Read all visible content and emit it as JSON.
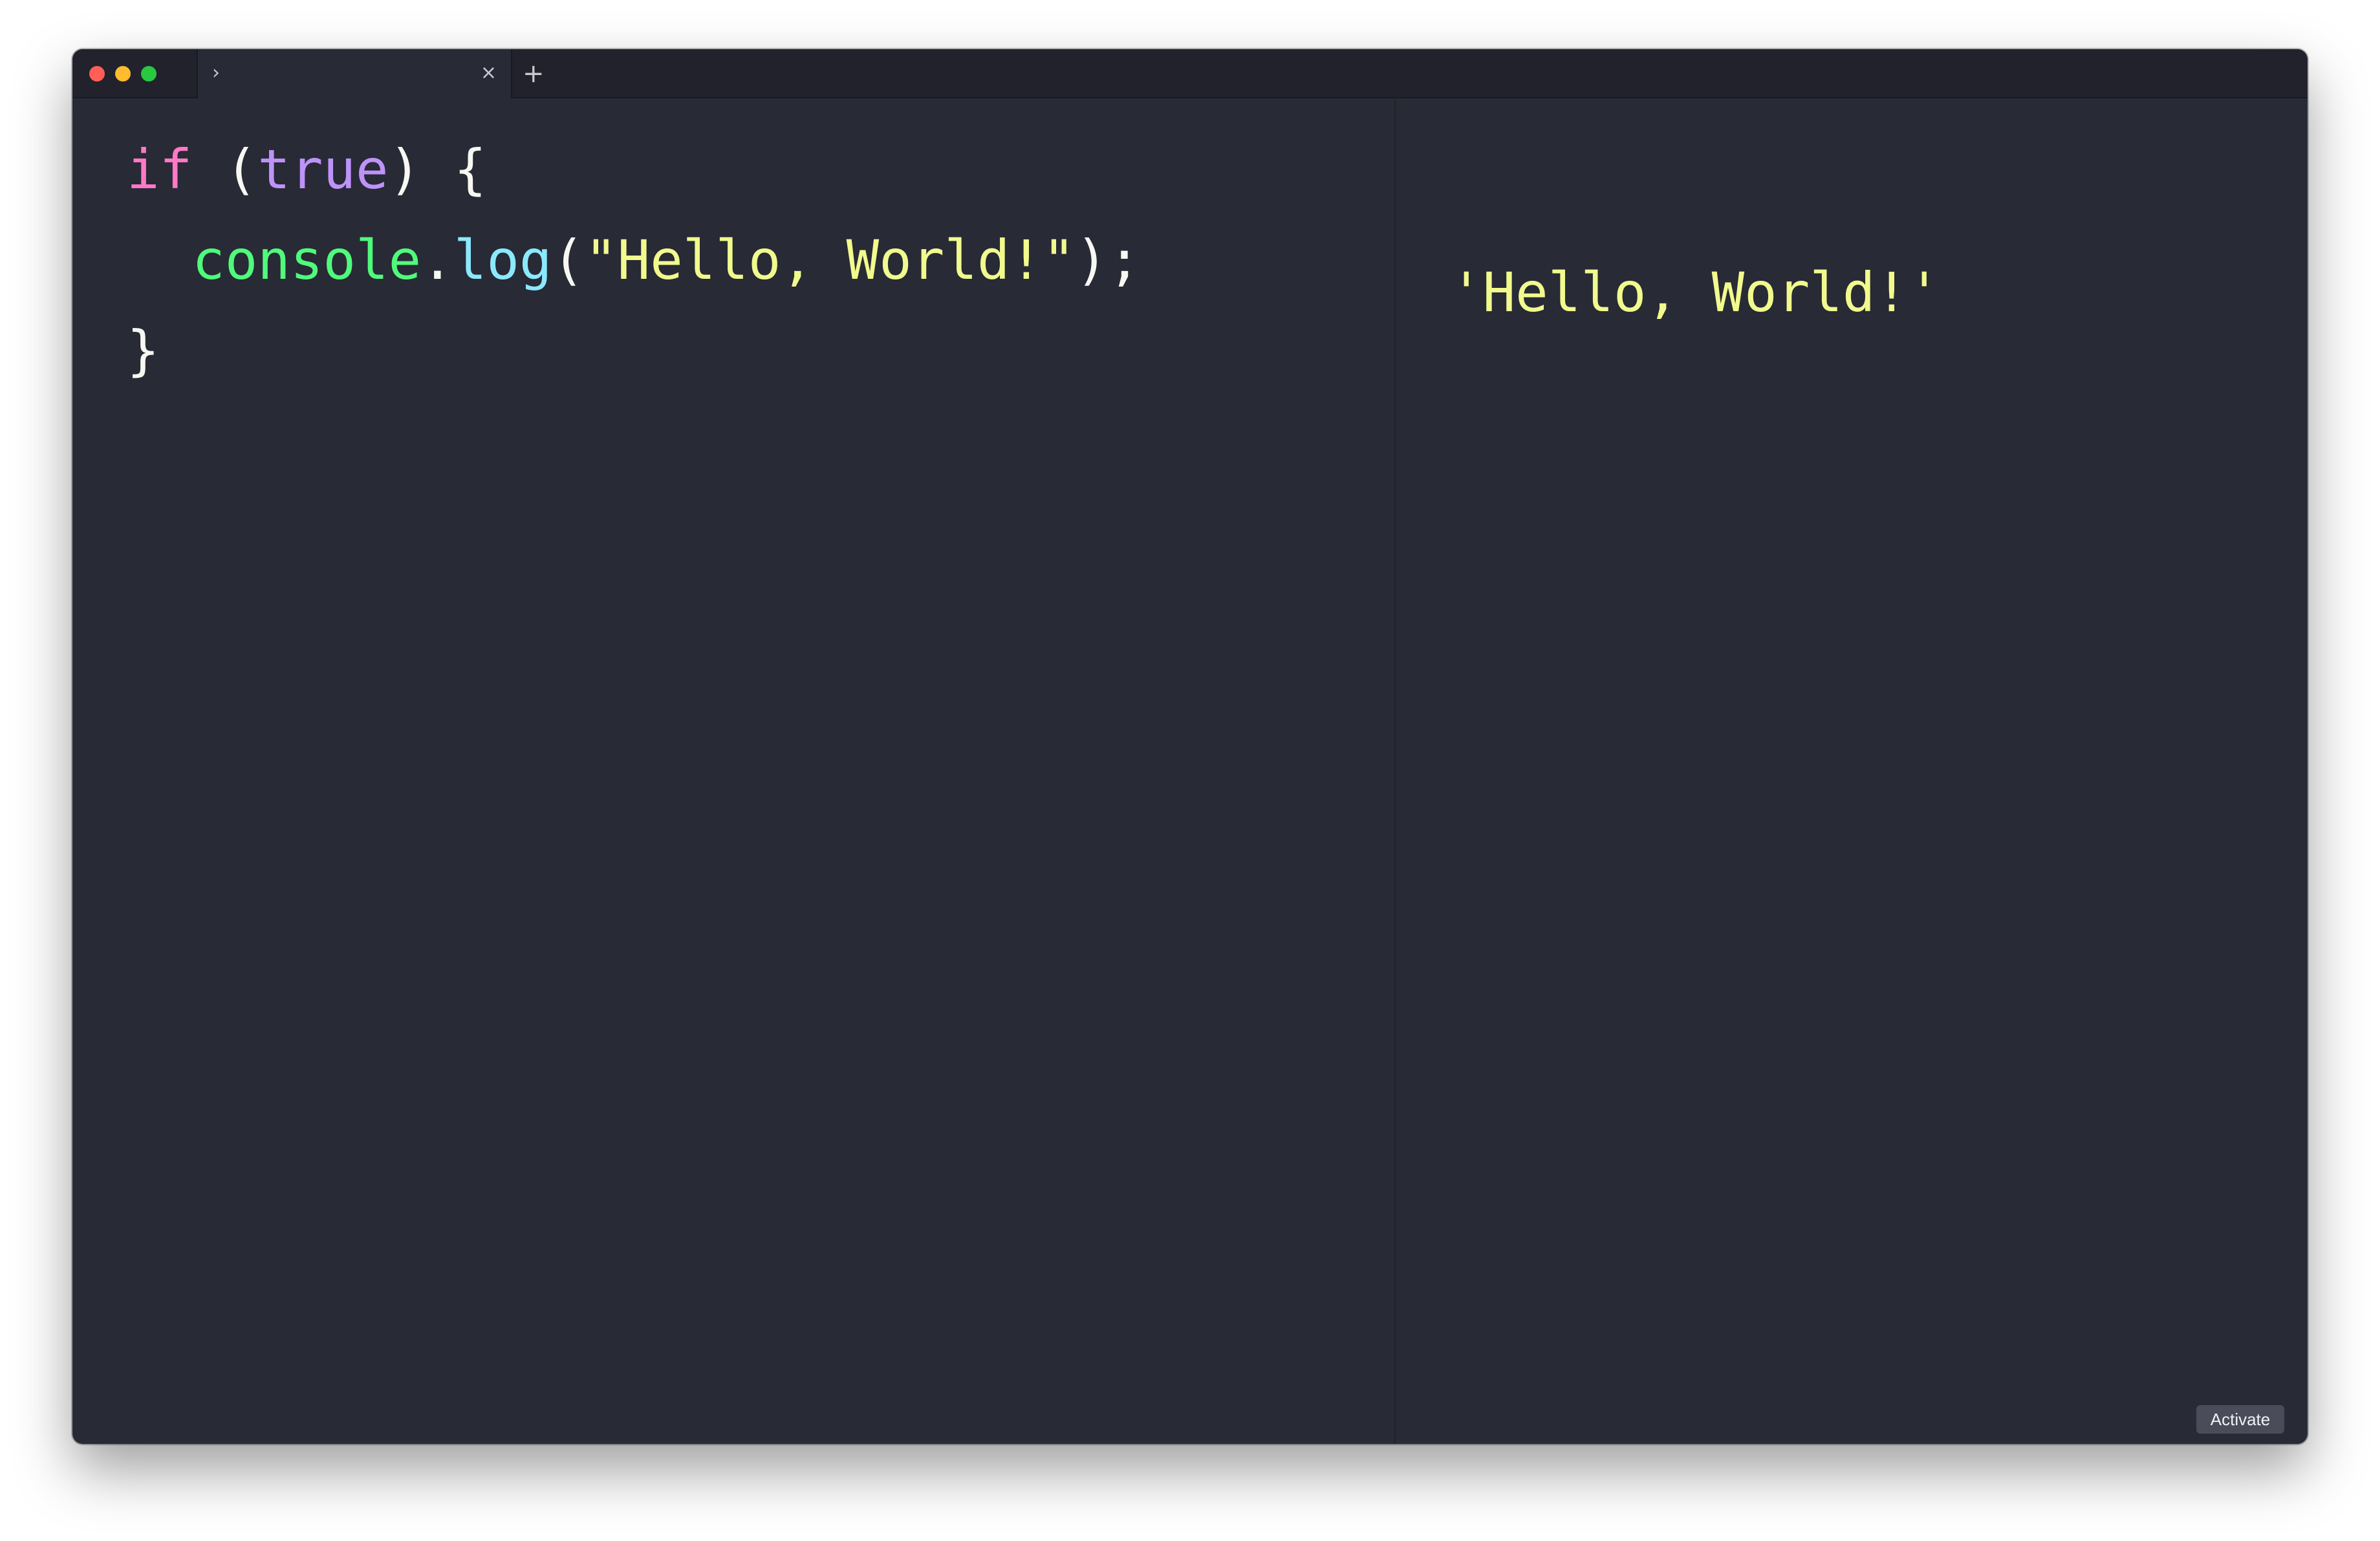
{
  "window": {
    "controls": [
      "close",
      "minimize",
      "maximize"
    ],
    "tab": {
      "icon": "chevron-right-icon",
      "close_icon": "close-icon",
      "chevron_glyph": "›",
      "close_glyph": "×"
    },
    "new_tab_glyph": "+"
  },
  "editor": {
    "line1": {
      "kw_if": "if",
      "open_paren": " (",
      "kw_true": "true",
      "close_paren_brace": ") {"
    },
    "line2": {
      "indent": "  ",
      "console": "console",
      "dot": ".",
      "log": "log",
      "open": "(",
      "string": "\"Hello, World!\"",
      "close": ");"
    },
    "line3": {
      "brace": "}"
    }
  },
  "output": {
    "line2": "'Hello, World!'"
  },
  "activate_label": "Activate",
  "colors": {
    "background": "#282a36",
    "keyword": "#ff79c6",
    "boolean": "#bd93f9",
    "identifier": "#50fa7b",
    "function": "#8be9fd",
    "string": "#f1fa8c",
    "text": "#f8f8f2"
  }
}
